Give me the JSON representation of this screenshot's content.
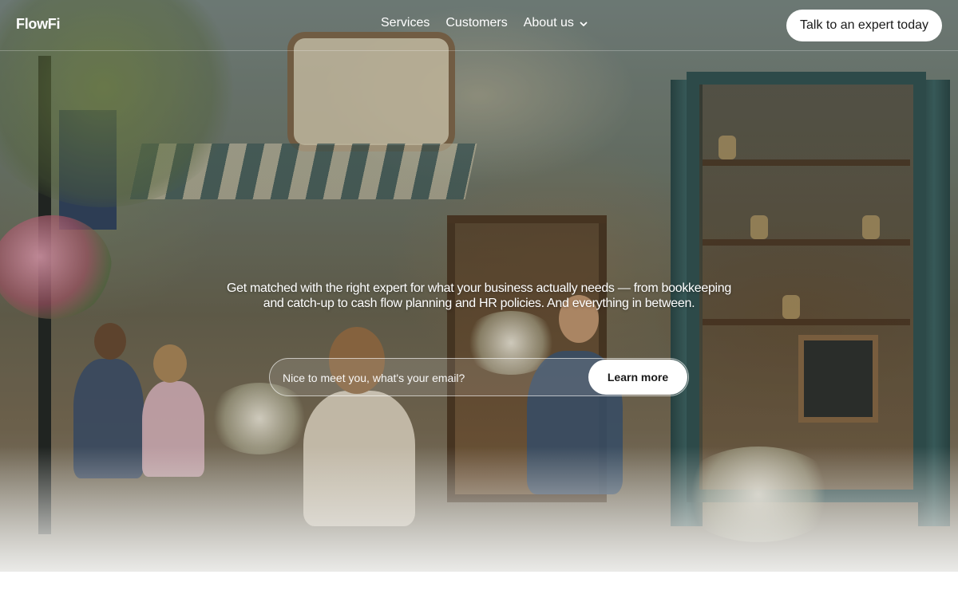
{
  "header": {
    "logo": "FlowFi",
    "nav": [
      {
        "label": "Services"
      },
      {
        "label": "Customers"
      },
      {
        "label": "About us",
        "has_dropdown": true
      }
    ],
    "cta_label": "Talk to an expert today"
  },
  "hero": {
    "subtitle": "Get matched with the right expert for what your business actually needs — from bookkeeping and catch-up to cash flow planning and HR policies. And everything in between.",
    "email_placeholder": "Nice to meet you, what's your email?",
    "submit_label": "Learn more"
  },
  "icons": {
    "about_dropdown": "chevron-down-icon"
  },
  "colors": {
    "text_on_hero": "#ffffff",
    "button_bg": "#ffffff",
    "button_text": "#1a1a1a"
  }
}
